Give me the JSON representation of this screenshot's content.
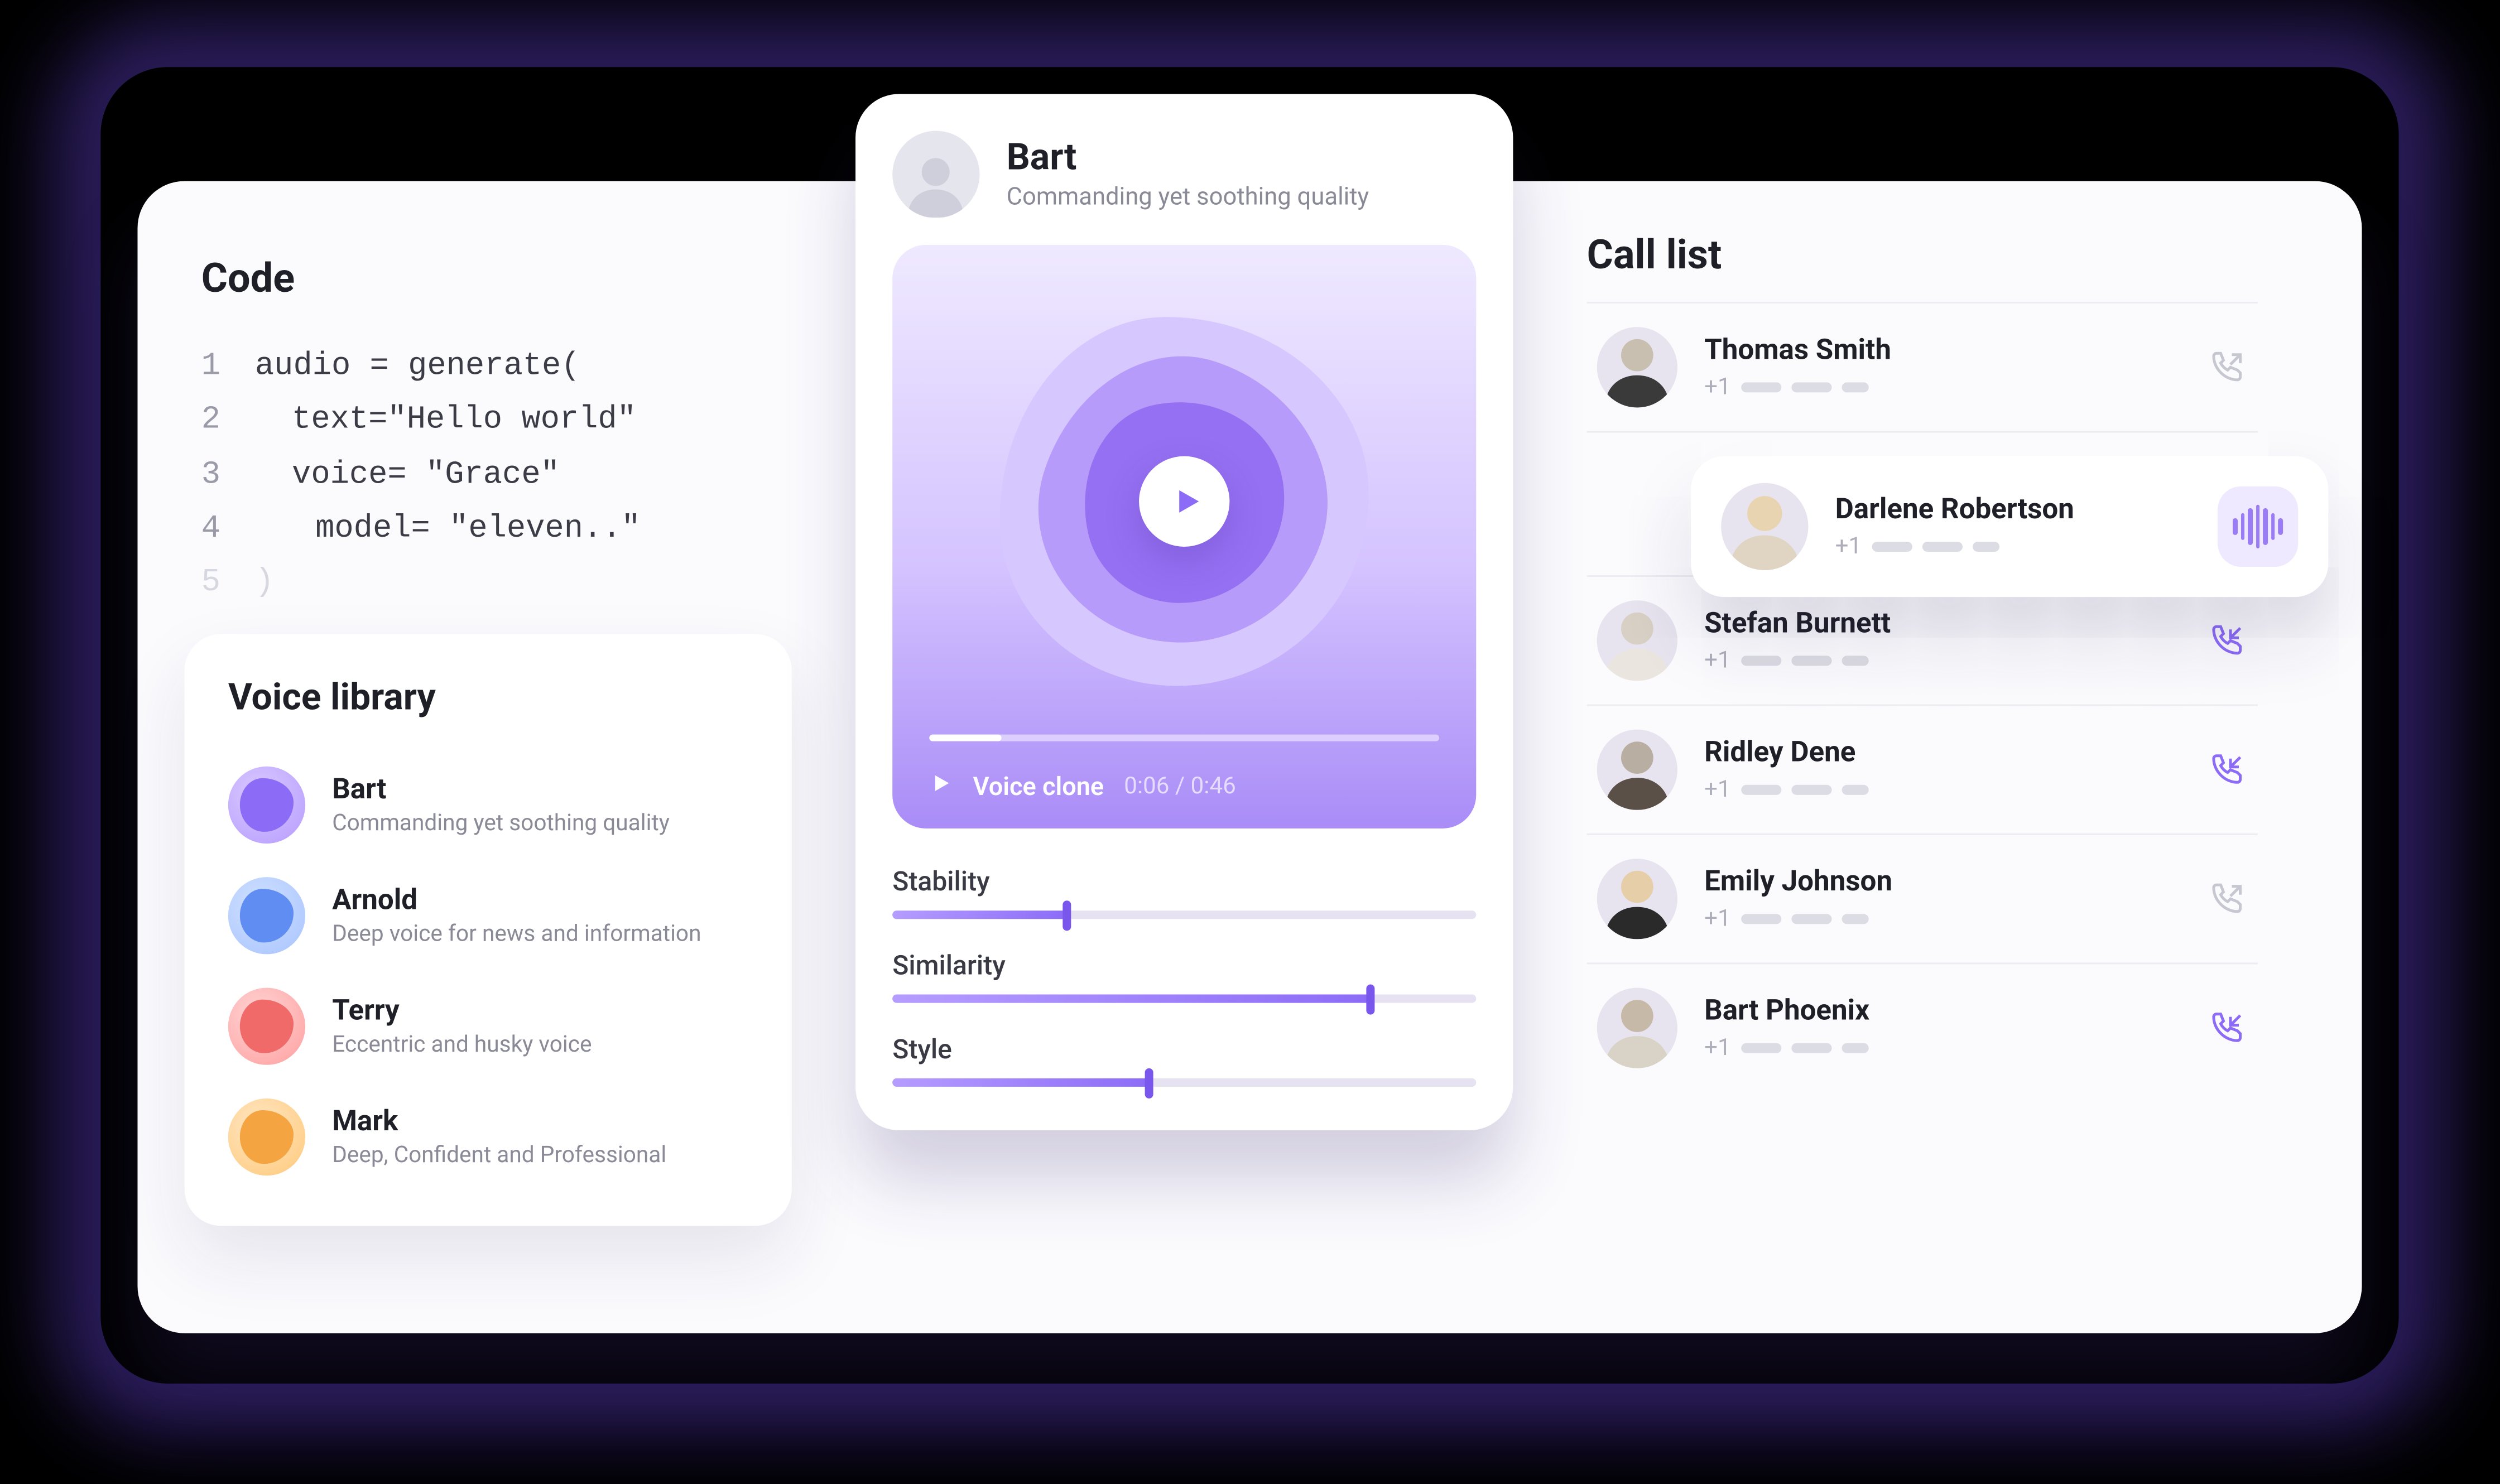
{
  "code": {
    "title": "Code",
    "lines": {
      "l1": "audio = generate(",
      "l2": "text=\"Hello world\"",
      "l3": "voice= \"Grace\"",
      "l4": "model= \"eleven..\"",
      "l5": ")"
    },
    "nums": {
      "n1": "1",
      "n2": "2",
      "n3": "3",
      "n4": "4",
      "n5": "5"
    }
  },
  "library": {
    "title": "Voice library",
    "items": [
      {
        "name": "Bart",
        "desc": "Commanding yet soothing quality",
        "color": "purple"
      },
      {
        "name": "Arnold",
        "desc": "Deep voice for news and information",
        "color": "blue"
      },
      {
        "name": "Terry",
        "desc": "Eccentric and husky voice",
        "color": "red"
      },
      {
        "name": "Mark",
        "desc": "Deep, Confident and Professional",
        "color": "orange"
      }
    ]
  },
  "player": {
    "name": "Bart",
    "subtitle": "Commanding yet soothing quality",
    "clip_label": "Voice clone",
    "time": "0:06 / 0:46",
    "sliders": {
      "stability": {
        "label": "Stability",
        "value": 30
      },
      "similarity": {
        "label": "Similarity",
        "value": 82
      },
      "style": {
        "label": "Style",
        "value": 44
      }
    }
  },
  "calls": {
    "title": "Call list",
    "floating": {
      "name": "Darlene Robertson",
      "prefix": "+1"
    },
    "rows": [
      {
        "name": "Thomas Smith",
        "prefix": "+1",
        "dir": "out",
        "active": false
      },
      {
        "name": "Stefan Burnett",
        "prefix": "+1",
        "dir": "in",
        "active": true
      },
      {
        "name": "Ridley Dene",
        "prefix": "+1",
        "dir": "in",
        "active": true
      },
      {
        "name": "Emily Johnson",
        "prefix": "+1",
        "dir": "out",
        "active": false
      },
      {
        "name": "Bart Phoenix",
        "prefix": "+1",
        "dir": "in",
        "active": true
      }
    ]
  }
}
